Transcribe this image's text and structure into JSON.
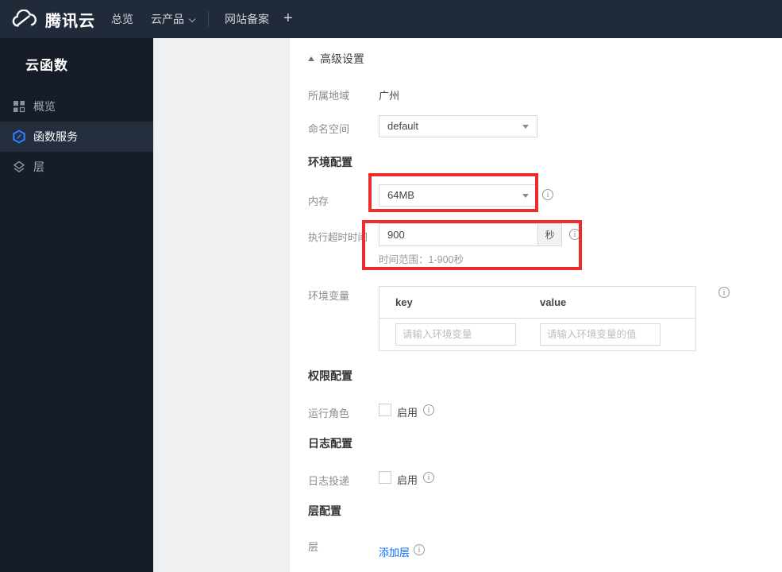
{
  "topnav": {
    "brand": "腾讯云",
    "items": [
      {
        "label": "总览"
      },
      {
        "label": "云产品",
        "has_caret": true
      },
      {
        "label": "网站备案"
      }
    ],
    "plus_label": "+"
  },
  "sidebar": {
    "title": "云函数",
    "items": [
      {
        "label": "概览",
        "icon": "grid-icon",
        "selected": false
      },
      {
        "label": "函数服务",
        "icon": "function-service-icon",
        "selected": true
      },
      {
        "label": "层",
        "icon": "layers-icon",
        "selected": false
      }
    ]
  },
  "main": {
    "advanced_toggle_label": "高级设置",
    "region": {
      "label": "所属地域",
      "value": "广州"
    },
    "namespace": {
      "label": "命名空间",
      "value": "default"
    },
    "env": {
      "title": "环境配置",
      "memory": {
        "label": "内存",
        "value": "64MB"
      },
      "timeout": {
        "label": "执行超时时间",
        "value": "900",
        "unit": "秒",
        "hint": "时间范围：1-900秒"
      },
      "vars": {
        "label": "环境变量",
        "key_header": "key",
        "value_header": "value",
        "key_placeholder": "请输入环境变量",
        "value_placeholder": "请输入环境变量的值"
      }
    },
    "perm": {
      "title": "权限配置",
      "run_role": {
        "label": "运行角色",
        "enable_label": "启用",
        "checked": false
      }
    },
    "log": {
      "title": "日志配置",
      "delivery": {
        "label": "日志投递",
        "enable_label": "启用",
        "checked": false
      }
    },
    "layer": {
      "title": "层配置",
      "row_label": "层",
      "add_link_label": "添加层"
    }
  },
  "colors": {
    "annotation_red": "#ee2c2c",
    "accent_blue": "#006eff",
    "nav_bg": "#202a39",
    "sidebar_bg": "#161d29"
  }
}
